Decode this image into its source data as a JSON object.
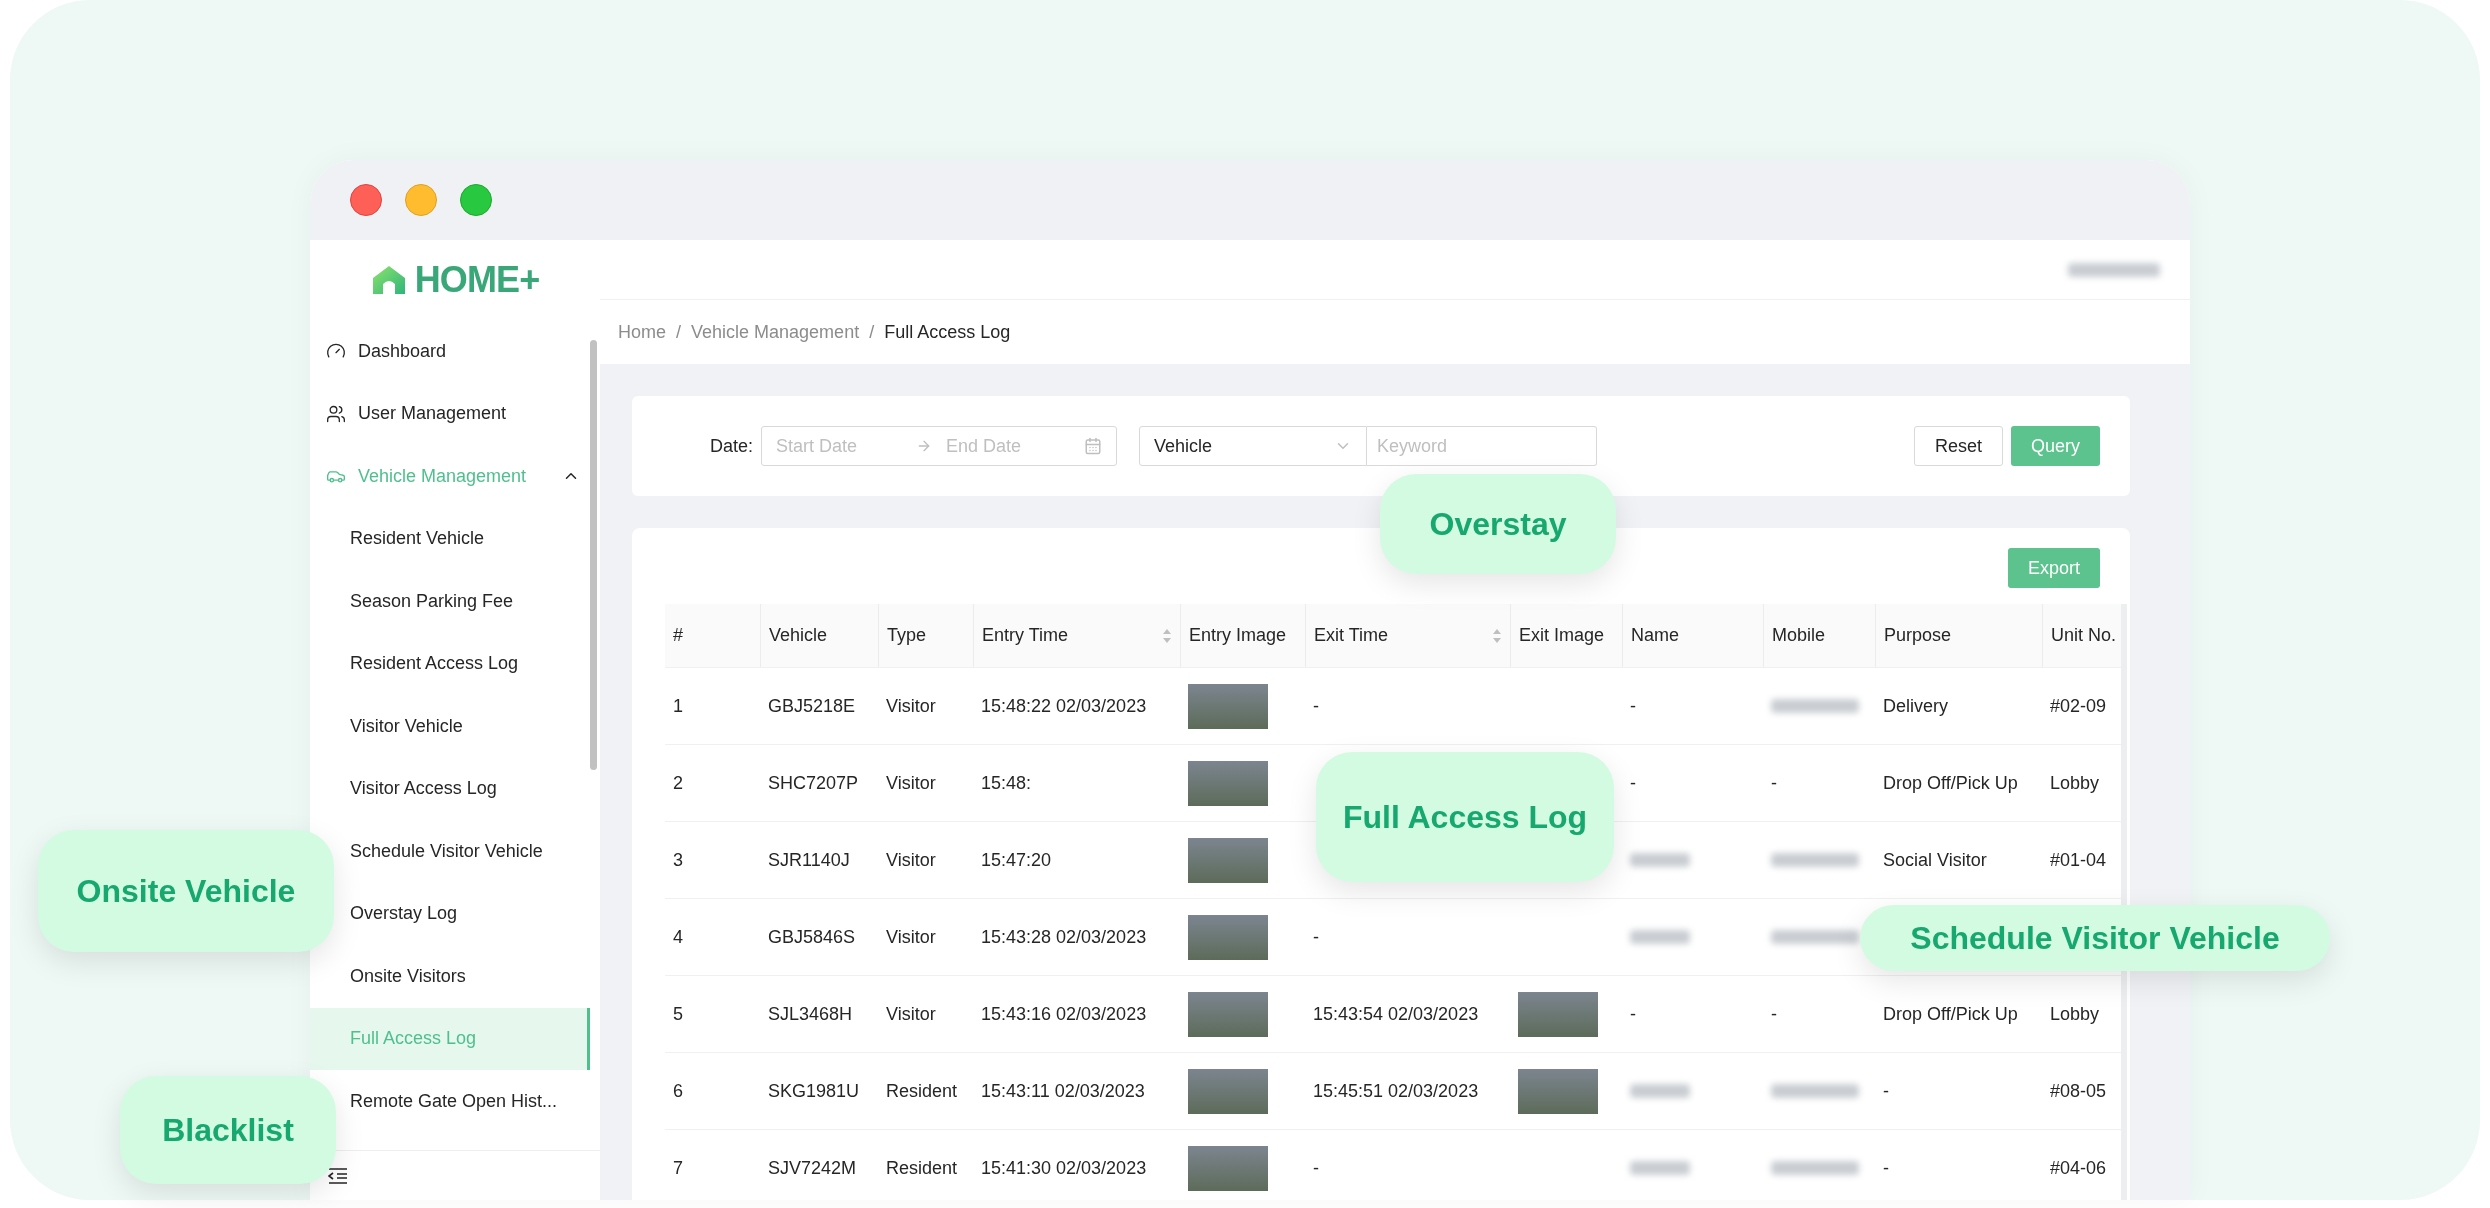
{
  "header": {
    "user_redacted": true
  },
  "sidebar": {
    "logo": "HOME+",
    "items": [
      {
        "label": "Dashboard",
        "active": false
      },
      {
        "label": "User Management",
        "active": false
      },
      {
        "label": "Vehicle Management",
        "active": true,
        "expanded": true,
        "children": [
          {
            "label": "Resident Vehicle",
            "selected": false
          },
          {
            "label": "Season Parking Fee",
            "selected": false
          },
          {
            "label": "Resident Access Log",
            "selected": false
          },
          {
            "label": "Visitor Vehicle",
            "selected": false
          },
          {
            "label": "Visitor Access Log",
            "selected": false
          },
          {
            "label": "Schedule Visitor Vehicle",
            "selected": false
          },
          {
            "label": "Overstay Log",
            "selected": false
          },
          {
            "label": "Onsite Visitors",
            "selected": false
          },
          {
            "label": "Full Access Log",
            "selected": true
          },
          {
            "label": "Remote Gate Open Hist...",
            "selected": false
          }
        ]
      }
    ]
  },
  "breadcrumb": {
    "separator": "/",
    "items": [
      "Home",
      "Vehicle Management",
      "Full Access Log"
    ]
  },
  "filters": {
    "date_label": "Date:",
    "start_placeholder": "Start Date",
    "end_placeholder": "End Date",
    "select_value": "Vehicle",
    "keyword_placeholder": "Keyword",
    "buttons": [
      {
        "label": "Reset",
        "kind": "default"
      },
      {
        "label": "Query",
        "kind": "primary"
      }
    ]
  },
  "toolbar": {
    "export": "Export"
  },
  "table": {
    "columns": [
      {
        "label": "#",
        "sortable": false
      },
      {
        "label": "Vehicle",
        "sortable": false
      },
      {
        "label": "Type",
        "sortable": false
      },
      {
        "label": "Entry Time",
        "sortable": true
      },
      {
        "label": "Entry Image",
        "sortable": false
      },
      {
        "label": "Exit Time",
        "sortable": true
      },
      {
        "label": "Exit Image",
        "sortable": false
      },
      {
        "label": "Name",
        "sortable": false
      },
      {
        "label": "Mobile",
        "sortable": false
      },
      {
        "label": "Purpose",
        "sortable": false
      },
      {
        "label": "Unit No.",
        "sortable": false
      }
    ],
    "rows": [
      {
        "no": "1",
        "vehicle": "GBJ5218E",
        "type": "Visitor",
        "entry_time": "15:48:22 02/03/2023",
        "entry_image": true,
        "exit_time": "-",
        "exit_image": false,
        "name": "-",
        "name_redacted": false,
        "mobile_redacted": true,
        "purpose": "Delivery",
        "unit": "#02-09"
      },
      {
        "no": "2",
        "vehicle": "SHC7207P",
        "type": "Visitor",
        "entry_time": "15:48:",
        "entry_image": true,
        "exit_image": false,
        "name": "-",
        "name_redacted": false,
        "mobile": "-",
        "mobile_redacted": false,
        "purpose": "Drop Off/Pick Up",
        "unit": "Lobby"
      },
      {
        "no": "3",
        "vehicle": "SJR1140J",
        "type": "Visitor",
        "entry_time": "15:47:20",
        "entry_image": true,
        "exit_image": false,
        "name_redacted": true,
        "mobile_redacted": true,
        "purpose": "Social Visitor",
        "unit": "#01-04"
      },
      {
        "no": "4",
        "vehicle": "GBJ5846S",
        "type": "Visitor",
        "entry_time": "15:43:28 02/03/2023",
        "entry_image": true,
        "exit_time": "-",
        "exit_image": false,
        "name_redacted": true,
        "mobile_redacted": true
      },
      {
        "no": "5",
        "vehicle": "SJL3468H",
        "type": "Visitor",
        "entry_time": "15:43:16 02/03/2023",
        "entry_image": true,
        "exit_time": "15:43:54 02/03/2023",
        "exit_image": true,
        "name": "-",
        "name_redacted": false,
        "mobile": "-",
        "mobile_redacted": false,
        "purpose": "Drop Off/Pick Up",
        "unit": "Lobby"
      },
      {
        "no": "6",
        "vehicle": "SKG1981U",
        "type": "Resident",
        "entry_time": "15:43:11 02/03/2023",
        "entry_image": true,
        "exit_time": "15:45:51 02/03/2023",
        "exit_image": true,
        "name_redacted": true,
        "mobile_redacted": true,
        "purpose": "-",
        "unit": "#08-05"
      },
      {
        "no": "7",
        "vehicle": "SJV7242M",
        "type": "Resident",
        "entry_time": "15:41:30 02/03/2023",
        "entry_image": true,
        "exit_time": "-",
        "exit_image": false,
        "name_redacted": true,
        "mobile_redacted": true,
        "purpose": "-",
        "unit": "#04-06"
      }
    ]
  },
  "callouts": [
    "Overstay",
    "Full Access Log",
    "Onsite Vehicle",
    "Schedule Visitor Vehicle",
    "Blacklist"
  ]
}
